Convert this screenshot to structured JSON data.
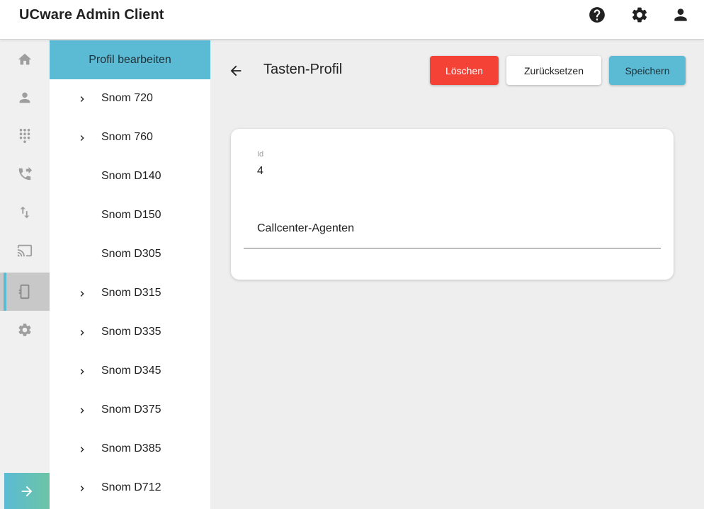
{
  "header": {
    "title": "UCware Admin Client",
    "icons": [
      "help-icon",
      "settings-icon",
      "account-icon"
    ]
  },
  "rail": {
    "items": [
      "home-icon",
      "user-icon",
      "dialpad-icon",
      "call-forward-icon",
      "swap-vertical-icon",
      "cast-icon",
      "phone-device-icon",
      "settings-icon"
    ],
    "active_index": 6,
    "expand_icon": "arrow-right-icon"
  },
  "tree": {
    "header": "Profil bearbeiten",
    "items": [
      {
        "label": "Snom 720",
        "expandable": true
      },
      {
        "label": "Snom 760",
        "expandable": true
      },
      {
        "label": "Snom D140",
        "expandable": false
      },
      {
        "label": "Snom D150",
        "expandable": false
      },
      {
        "label": "Snom D305",
        "expandable": false
      },
      {
        "label": "Snom D315",
        "expandable": true
      },
      {
        "label": "Snom D335",
        "expandable": true
      },
      {
        "label": "Snom D345",
        "expandable": true
      },
      {
        "label": "Snom D375",
        "expandable": true
      },
      {
        "label": "Snom D385",
        "expandable": true
      },
      {
        "label": "Snom D712",
        "expandable": true
      }
    ]
  },
  "main": {
    "title": "Tasten-Profil",
    "buttons": {
      "delete": "Löschen",
      "reset": "Zurücksetzen",
      "save": "Speichern"
    },
    "form": {
      "id_label": "Id",
      "id_value": "4",
      "name_value": "Callcenter-Agenten"
    }
  },
  "colors": {
    "accent": "#5bbbd4",
    "danger": "#f44336",
    "background": "#eeeeee"
  }
}
